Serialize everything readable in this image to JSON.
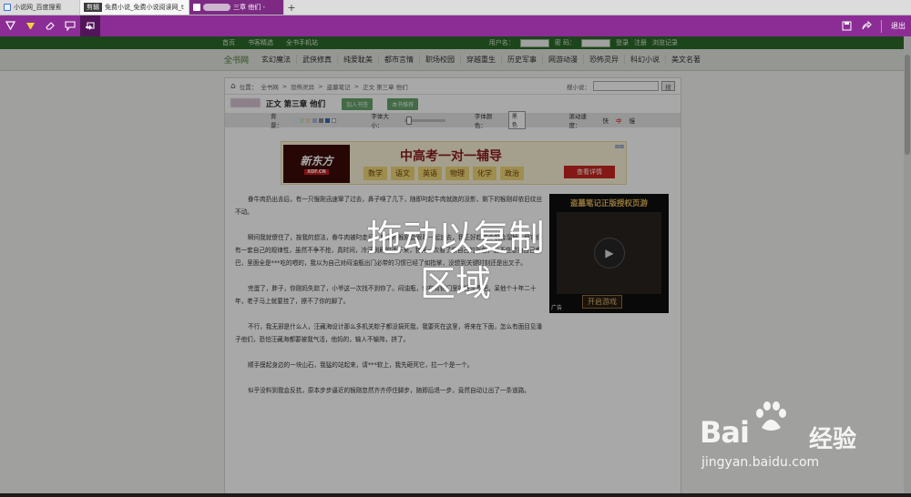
{
  "browser": {
    "tabs": [
      {
        "label": "小说网_百度搜索"
      },
      {
        "label": "剪辑"
      },
      {
        "label": "免费小说_免费小说阅读网_t"
      },
      {
        "label": "三章 他们 -"
      }
    ],
    "new_tab_symbol": "+"
  },
  "capture_toolbar": {
    "exit_label": "退出",
    "accent_color": "#8c2d96"
  },
  "site": {
    "topnav": [
      "首页",
      "书客精选",
      "全书手机站"
    ],
    "login": {
      "username_label": "用户名：",
      "password_label": "密 码：",
      "login_button": "登录",
      "register_button": "注册",
      "history": "浏览记录"
    },
    "logo": "全书网",
    "categories": [
      "玄幻魔法",
      "武侠修真",
      "纯爱耽美",
      "都市言情",
      "职场校园",
      "穿越重生",
      "历史军事",
      "网游动漫",
      "恐怖灵异",
      "科幻小说",
      "美文名著"
    ]
  },
  "reader": {
    "breadcrumb": [
      "位置：",
      "全书网",
      ">",
      "恐怖灵异",
      ">",
      "盗墓笔记",
      ">",
      "正文 第三章 他们"
    ],
    "search_label": "搜小说：",
    "search_button": "搜",
    "chapter_title": "正文 第三章 他们",
    "add_bookshelf": "加入书签",
    "recommend": "本书推荐",
    "settings": {
      "bg_label": "背景：",
      "font_size_label": "字体大小：",
      "font_color_label": "字体颜色：",
      "font_color_value": "黑色",
      "scroll_label": "滚动速度：",
      "scroll_options": [
        "快",
        "中",
        "慢"
      ]
    },
    "paragraphs": [
      "眷牛肉扔出去后，有一只猴刚迅速窜了过去，鼻子嗅了几下，随即叼起牛肉就跑的没影，剩下的猴刚却依旧纹丝不动。",
      "瞬间我就傻住了，按我的想法，眷牛肉被叼走后，其余的猴刚会跟着一起追去，我正好趁这个机会溜掉。但它们有一套自己的规律性，虽然不争不抢，真时间，冷汗刷刷的淌下来，我再一次看了眼自己的背包，忍不住想抽自己嘴巴，里面全是***吃的喂的，我以为自己对闷油瓶出门必带的习惯已经了如指掌，没想到关键时刻还是出叉子。",
      "完蛋了，胖子，你刚妈失踪了，小爷这一次找不到你了。闷油瓶，你在青铜门里好好享着吧，呆他个十年二十年，老子马上就要挂了，撩不了你的脚了。",
      "不行，我无邪是什么人，汪藏海设计那么多机关粽子都没搞死我，我要死在这里，将来在下面，怎么有面目见潘子他们，恐怕汪藏海都要被我气活，他妈的，输人不输阵，拼了。",
      "顺手摸起身边的一块山石，我猛的站起来，请***软上，我先砸死它，拉一个是一个。",
      "似乎没料到我会反抗，原本步步逼近的猴刚忽然齐齐停住脚步，随即后退一步，竟然自动让出了一条道路。"
    ]
  },
  "ads": {
    "banner": {
      "logo": "新东方",
      "logo_sub": "XDF.CN",
      "headline": "中高考一对一辅导",
      "subjects": [
        "数学",
        "语文",
        "英语",
        "物理",
        "化学",
        "政治"
      ],
      "cta": "查看详情"
    },
    "video": {
      "banner": "盗墓笔记正版授权页游",
      "start": "开启游戏",
      "tag": "广告"
    }
  },
  "overlay": {
    "hint": "拖动以复制区域"
  },
  "watermark": {
    "brand": "Bai",
    "brand_cn": "经验",
    "url": "jingyan.baidu.com"
  }
}
